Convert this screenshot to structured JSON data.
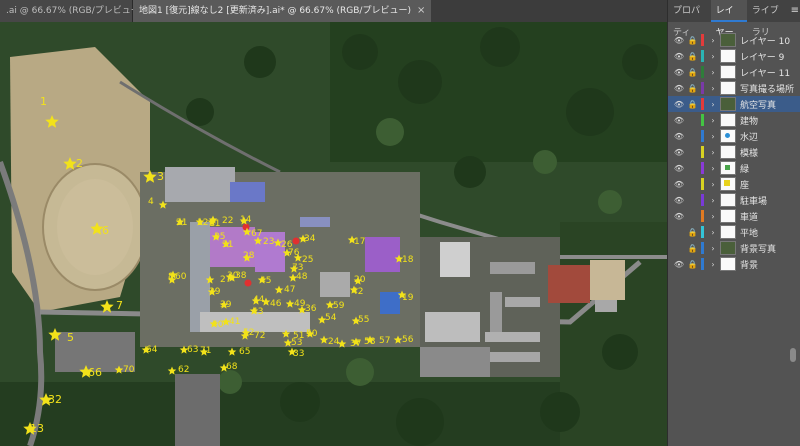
{
  "doc_tabs": [
    {
      "label": ".ai @ 66.67% (RGB/プレビュー)",
      "close": "×"
    },
    {
      "label": "地図1 [復元]線なし2 [更新済み].ai* @ 66.67% (RGB/プレビュー)",
      "close": "×"
    }
  ],
  "panel": {
    "tabs": [
      "プロパティ",
      "レイヤー",
      "ライブラリ"
    ],
    "active_tab": "レイヤー",
    "menu_icon": "≡"
  },
  "layers": [
    {
      "name": "レイヤー 10",
      "color": "#e23b3b",
      "eye": true,
      "lock": true,
      "thumb": "photo"
    },
    {
      "name": "レイヤー 9",
      "color": "#2bb3b3",
      "eye": true,
      "lock": true,
      "thumb": "blank"
    },
    {
      "name": "レイヤー 11",
      "color": "#2e7d3a",
      "eye": true,
      "lock": true,
      "thumb": "blank"
    },
    {
      "name": "写真撮る場所",
      "color": "#7a3aa8",
      "eye": true,
      "lock": true,
      "thumb": "blank"
    },
    {
      "name": "航空写真",
      "color": "#e23b3b",
      "eye": true,
      "lock": true,
      "thumb": "photo",
      "selected": true
    },
    {
      "name": "建物",
      "color": "#43c443",
      "eye": true,
      "lock": false,
      "thumb": "blank"
    },
    {
      "name": "水辺",
      "color": "#2f7ad1",
      "eye": true,
      "lock": false,
      "thumb": "water"
    },
    {
      "name": "模様",
      "color": "#d8d222",
      "eye": true,
      "lock": false,
      "thumb": "blank"
    },
    {
      "name": "緑",
      "color": "#8a3ad8",
      "eye": true,
      "lock": false,
      "thumb": "green"
    },
    {
      "name": "座",
      "color": "#d8d222",
      "eye": true,
      "lock": false,
      "thumb": "mark"
    },
    {
      "name": "駐車場",
      "color": "#7a3ad8",
      "eye": true,
      "lock": false,
      "thumb": "blank"
    },
    {
      "name": "車道",
      "color": "#e07a22",
      "eye": true,
      "lock": false,
      "thumb": "blank"
    },
    {
      "name": "平地",
      "color": "#33c4d8",
      "eye": false,
      "lock": true,
      "thumb": "blank"
    },
    {
      "name": "背景写真",
      "color": "#2f7ad1",
      "eye": false,
      "lock": true,
      "thumb": "photo"
    },
    {
      "name": "背景",
      "color": "#2f7ad1",
      "eye": true,
      "lock": true,
      "thumb": "blank"
    }
  ],
  "map_labels": [
    {
      "n": "1"
    },
    {
      "n": "2"
    },
    {
      "n": "3"
    },
    {
      "n": "4"
    },
    {
      "n": "5"
    },
    {
      "n": "6"
    },
    {
      "n": "7"
    },
    {
      "n": "8"
    },
    {
      "n": "11"
    },
    {
      "n": "12"
    },
    {
      "n": "13"
    },
    {
      "n": "14"
    },
    {
      "n": "17"
    },
    {
      "n": "18"
    },
    {
      "n": "19"
    },
    {
      "n": "20"
    },
    {
      "n": "21"
    },
    {
      "n": "22"
    },
    {
      "n": "23"
    },
    {
      "n": "24"
    },
    {
      "n": "25"
    },
    {
      "n": "26"
    },
    {
      "n": "27"
    },
    {
      "n": "28"
    },
    {
      "n": "29"
    },
    {
      "n": "30"
    },
    {
      "n": "31"
    },
    {
      "n": "32"
    },
    {
      "n": "33"
    },
    {
      "n": "34"
    },
    {
      "n": "35"
    },
    {
      "n": "36"
    },
    {
      "n": "37"
    },
    {
      "n": "38"
    },
    {
      "n": "39"
    },
    {
      "n": "40"
    },
    {
      "n": "41"
    },
    {
      "n": "42"
    },
    {
      "n": "43"
    },
    {
      "n": "44"
    },
    {
      "n": "45"
    },
    {
      "n": "46"
    },
    {
      "n": "47"
    },
    {
      "n": "48"
    },
    {
      "n": "49"
    },
    {
      "n": "50"
    },
    {
      "n": "51"
    },
    {
      "n": "52"
    },
    {
      "n": "53"
    },
    {
      "n": "54"
    },
    {
      "n": "55"
    },
    {
      "n": "56"
    },
    {
      "n": "57"
    },
    {
      "n": "58"
    },
    {
      "n": "59"
    },
    {
      "n": "60"
    },
    {
      "n": "62"
    },
    {
      "n": "63"
    },
    {
      "n": "64"
    },
    {
      "n": "65"
    },
    {
      "n": "66"
    },
    {
      "n": "67"
    },
    {
      "n": "68"
    },
    {
      "n": "70"
    },
    {
      "n": "71"
    },
    {
      "n": "72"
    },
    {
      "n": "73"
    },
    {
      "n": "76"
    }
  ]
}
